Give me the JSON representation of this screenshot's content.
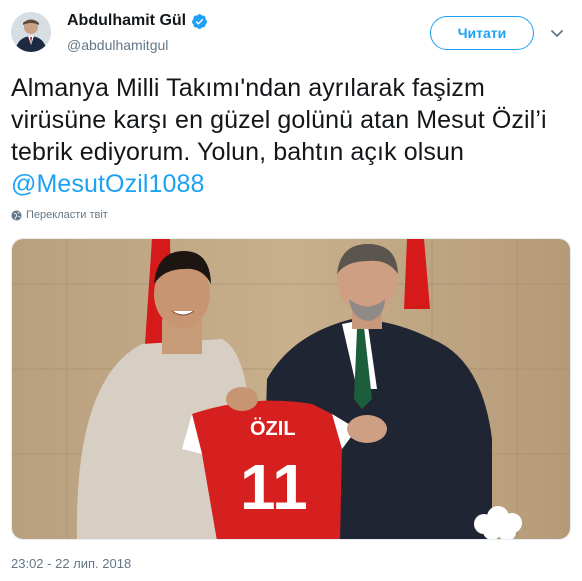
{
  "author": {
    "display_name": "Abdulhamit Gül",
    "handle": "@abdulhamitgul",
    "verified": true
  },
  "follow_button": "Читати",
  "tweet": {
    "text": "Almanya Milli Takımı'ndan ayrılarak faşizm virüsüne karşı en güzel golünü atan Mesut Özil’i tebrik ediyorum. Yolun, bahtın açık olsun ",
    "mention": "@MesutOzil1088"
  },
  "translate_label": "Перекласти твіт",
  "photo": {
    "jersey_name": "ÖZIL",
    "jersey_number": "11"
  },
  "timestamp": "23:02 - 22 лип. 2018",
  "icons": [
    "verified-badge-icon",
    "chevron-down-icon",
    "globe-icon"
  ],
  "colors": {
    "accent": "#1da1f2",
    "secondary_text": "#657786"
  }
}
